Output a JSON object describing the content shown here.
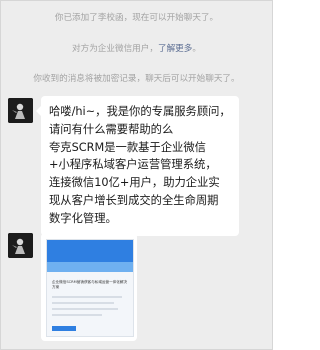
{
  "system_messages": {
    "line1": "你已添加了李校函，现在可以开始聊天了。",
    "line2_prefix": "对方为企业微信用户，",
    "line2_link": "了解更多",
    "line2_suffix": "。",
    "line3": "你收到的消息将被加密记录，聊天后可以开始聊天了。"
  },
  "message": {
    "lines": [
      "哈喽/hi~，我是你的专属服务顾问，",
      "请问有什么需要帮助的么",
      "夸克SCRM是一款基于企业微信",
      "+小程序私域客户运营管理系统，",
      "连接微信10亿+用户，助力企业实",
      "现从客户增长到成交的全生命周期",
      "数字化管理。"
    ]
  },
  "card": {
    "title": "企业微信SCRM营销获客与私域运营一体化解决方案"
  },
  "colors": {
    "background": "#ededed",
    "bubble": "#ffffff",
    "link": "#5b6d92",
    "system_text": "#a3a3a3",
    "card_accent": "#2f7fe1"
  }
}
